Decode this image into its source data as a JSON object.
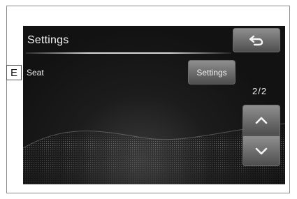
{
  "header": {
    "title": "Settings"
  },
  "toolbar": {
    "back_icon": "return-arrow-icon"
  },
  "rows": [
    {
      "label": "Seat",
      "button_label": "Settings"
    }
  ],
  "pagination": {
    "indicator": "2/2",
    "up_icon": "chevron-up-icon",
    "down_icon": "chevron-down-icon"
  },
  "callout": {
    "letter": "E"
  }
}
